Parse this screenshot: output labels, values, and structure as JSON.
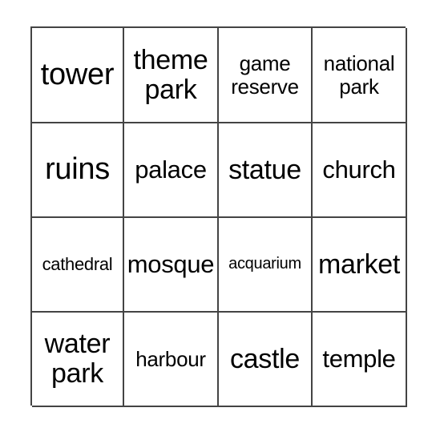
{
  "card": {
    "rows": 4,
    "columns": 4,
    "border_color": "#444444",
    "text_color": "#000000",
    "background_color": "#ffffff",
    "cells": [
      {
        "text": "tower",
        "size": "fs-xl",
        "lines": 1
      },
      {
        "text": "theme\npark",
        "size": "fs-lg",
        "lines": 2
      },
      {
        "text": "game\nreserve",
        "size": "fs-sm",
        "lines": 2
      },
      {
        "text": "national\npark",
        "size": "fs-sm",
        "lines": 2
      },
      {
        "text": "ruins",
        "size": "fs-xl",
        "lines": 1
      },
      {
        "text": "palace",
        "size": "fs-md",
        "lines": 1
      },
      {
        "text": "statue",
        "size": "fs-lg",
        "lines": 1
      },
      {
        "text": "church",
        "size": "fs-md",
        "lines": 1
      },
      {
        "text": "cathedral",
        "size": "fs-xs",
        "lines": 1
      },
      {
        "text": "mosque",
        "size": "fs-md",
        "lines": 1
      },
      {
        "text": "acquarium",
        "size": "fs-xxs",
        "lines": 1
      },
      {
        "text": "market",
        "size": "fs-lg",
        "lines": 1
      },
      {
        "text": "water\npark",
        "size": "fs-lg",
        "lines": 2
      },
      {
        "text": "harbour",
        "size": "fs-sm",
        "lines": 1
      },
      {
        "text": "castle",
        "size": "fs-lg",
        "lines": 1
      },
      {
        "text": "temple",
        "size": "fs-md",
        "lines": 1
      }
    ]
  }
}
